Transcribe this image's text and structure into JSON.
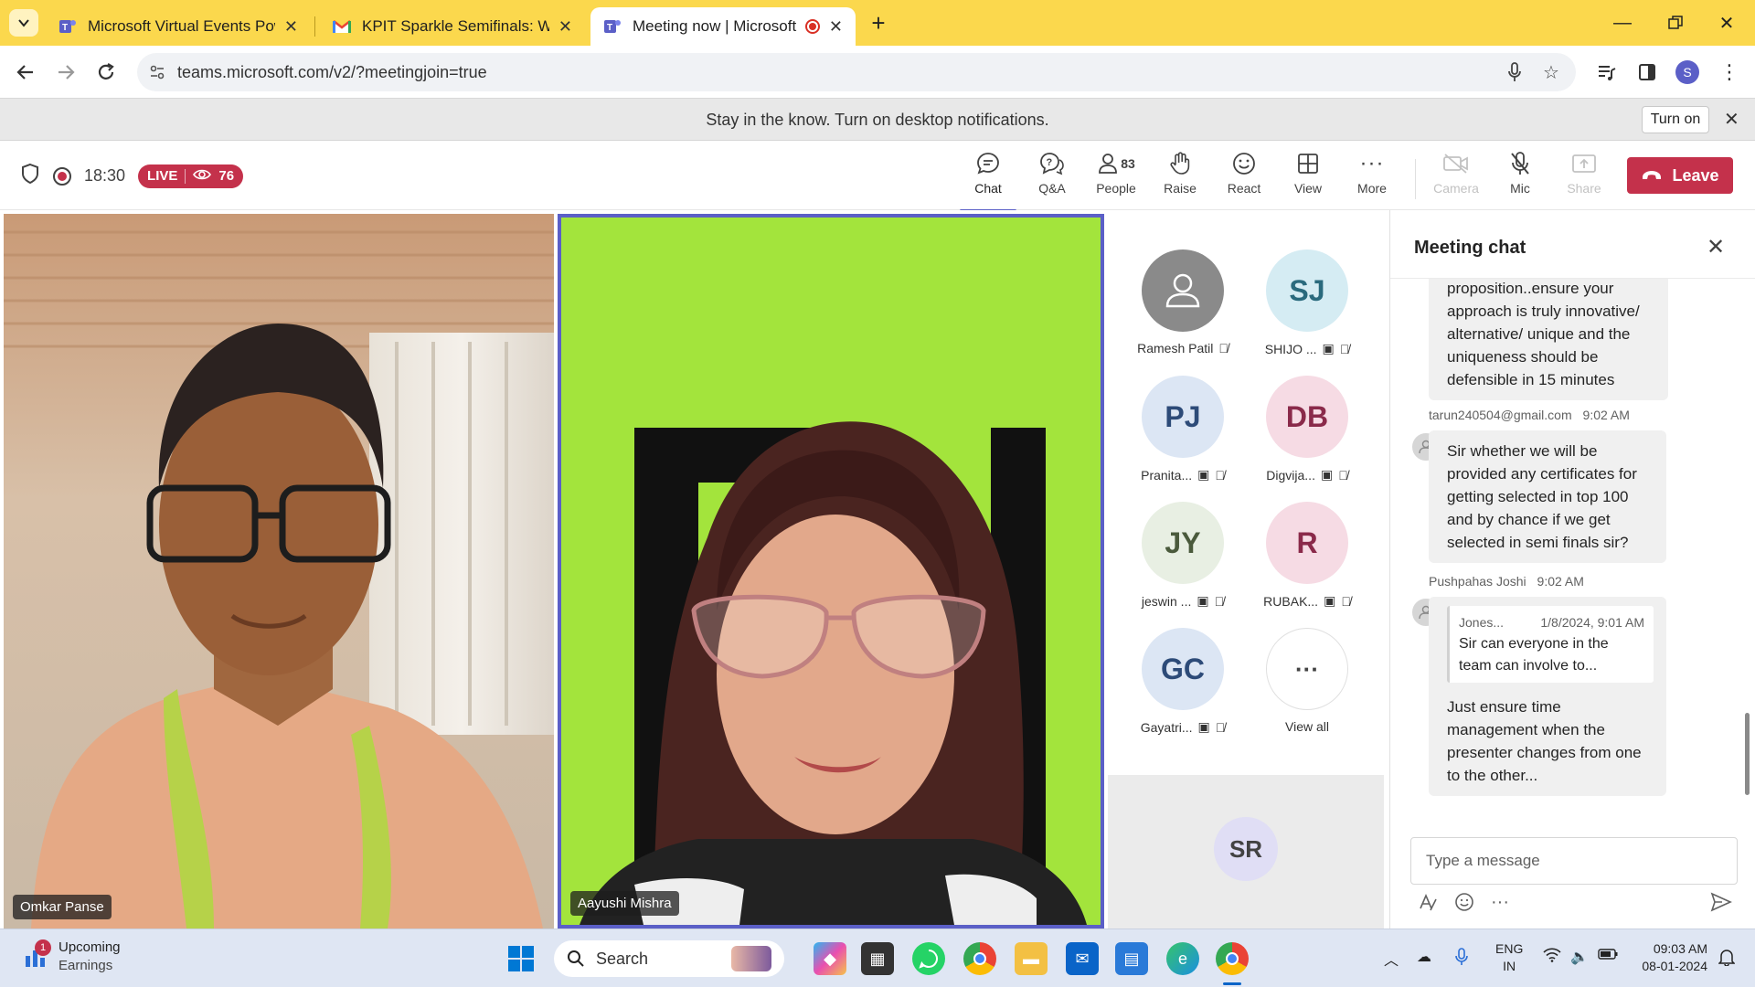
{
  "browser": {
    "tabs": [
      {
        "title": "Microsoft Virtual Events Powered",
        "active": false
      },
      {
        "title": "KPIT Sparkle Semifinals: What to",
        "active": false
      },
      {
        "title": "Meeting now | Microsoft Teams",
        "active": true
      }
    ],
    "url": "teams.microsoft.com/v2/?meetingjoin=true",
    "profile_initial": "S"
  },
  "notification": {
    "message": "Stay in the know. Turn on desktop notifications.",
    "button": "Turn on"
  },
  "meeting": {
    "timer": "18:30",
    "live_label": "LIVE",
    "viewer_count": "76",
    "people_count": "83",
    "controls": {
      "chat": "Chat",
      "qa": "Q&A",
      "people": "People",
      "raise": "Raise",
      "react": "React",
      "view": "View",
      "more": "More",
      "camera": "Camera",
      "mic": "Mic",
      "share": "Share"
    },
    "leave": "Leave"
  },
  "videos": [
    {
      "name": "Omkar Panse"
    },
    {
      "name": "Aayushi Mishra"
    }
  ],
  "participants": [
    {
      "initials": "",
      "name": "Ramesh Patil",
      "color": "#8a8a8a",
      "text_color": "#ffffff"
    },
    {
      "initials": "SJ",
      "name": "SHIJO ...",
      "color": "#d5ecf3",
      "text_color": "#2a6a7d"
    },
    {
      "initials": "PJ",
      "name": "Pranita...",
      "color": "#dce6f4",
      "text_color": "#2d4b78"
    },
    {
      "initials": "DB",
      "name": "Digvija...",
      "color": "#f6dbe4",
      "text_color": "#8a2a4a"
    },
    {
      "initials": "JY",
      "name": "jeswin ...",
      "color": "#e8efe3",
      "text_color": "#4a5a3c"
    },
    {
      "initials": "R",
      "name": "RUBAK...",
      "color": "#f6dbe4",
      "text_color": "#8a2a4a"
    },
    {
      "initials": "GC",
      "name": "Gayatri...",
      "color": "#dce6f4",
      "text_color": "#2d4b78"
    },
    {
      "initials": "···",
      "name": "View all",
      "color": "#ffffff",
      "text_color": "#424242"
    }
  ],
  "extra_participant": {
    "initials": "SR"
  },
  "chat": {
    "title": "Meeting chat",
    "messages": [
      {
        "text": "proposition..ensure your approach is truly innovative/ alternative/ unique and the uniqueness should be defensible in 15 minutes"
      },
      {
        "sender": "tarun240504@gmail.com",
        "time": "9:02 AM",
        "text": "Sir whether we will be provided any certificates for getting selected in top 100 and by chance if we get selected in semi finals sir?"
      },
      {
        "sender": "Pushpahas Joshi",
        "time": "9:02 AM",
        "quote_author": "Jones...",
        "quote_time": "1/8/2024, 9:01 AM",
        "quote_text": "Sir can everyone in the team can involve to...",
        "text": "Just ensure time management when the presenter changes from one to the other..."
      }
    ],
    "compose_placeholder": "Type a message"
  },
  "taskbar": {
    "weather_title": "Upcoming",
    "weather_sub": "Earnings",
    "weather_badge": "1",
    "search": "Search",
    "lang_top": "ENG",
    "lang_bottom": "IN",
    "time": "09:03 AM",
    "date": "08-01-2024"
  }
}
